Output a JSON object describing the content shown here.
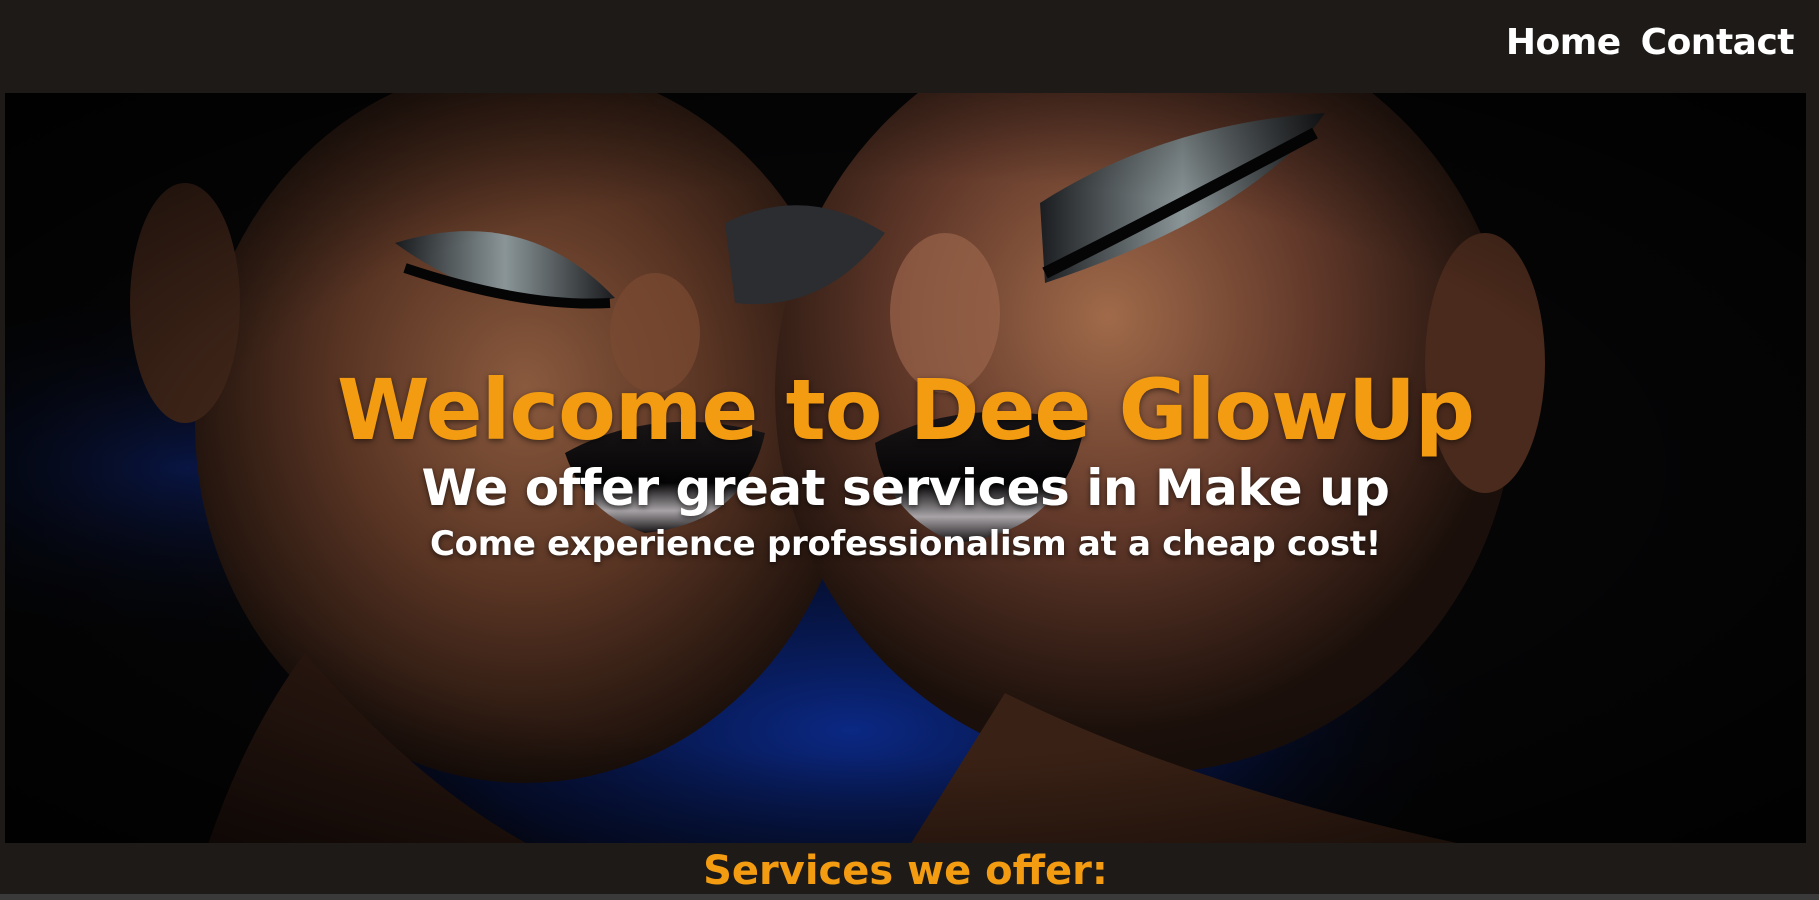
{
  "nav": {
    "items": [
      {
        "label": "Home"
      },
      {
        "label": "Contact"
      }
    ]
  },
  "hero": {
    "title": "Welcome to Dee GlowUp",
    "subtitle": "We offer great services in Make up",
    "tagline": "Come experience professionalism at a cheap cost!"
  },
  "services": {
    "heading": "Services we offer:"
  },
  "colors": {
    "background": "#1e1a17",
    "accent": "#f39c12",
    "text": "#ffffff"
  }
}
